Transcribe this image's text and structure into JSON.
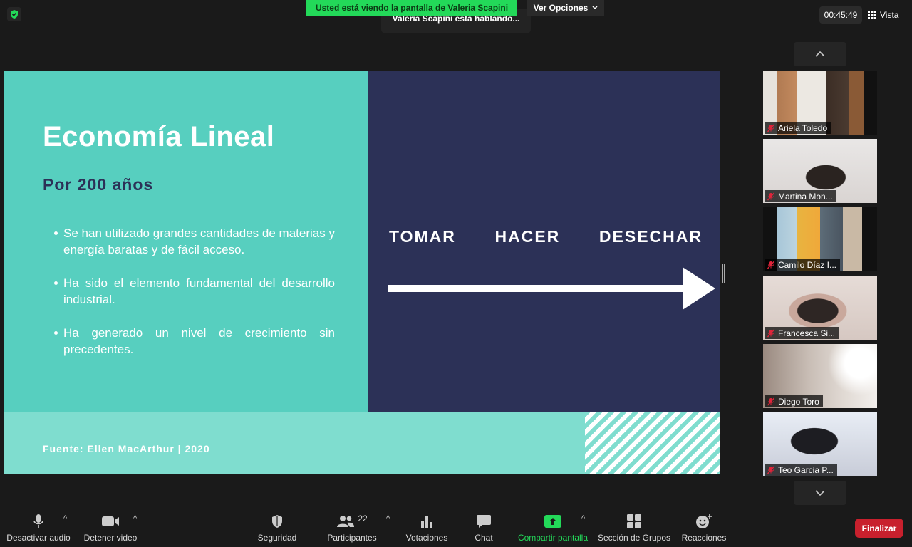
{
  "top_bar": {
    "share_banner": "Usted está viendo la pantalla de Valeria Scapini",
    "view_options": "Ver Opciones",
    "speaking": "Valeria Scapini está hablando...",
    "timer": "00:45:49",
    "view_label": "Vista"
  },
  "slide": {
    "title": "Economía Lineal",
    "subtitle": "Por 200 años",
    "bullets": [
      "Se han utilizado grandes cantidades de materias y energía baratas y de fácil acceso.",
      "Ha sido el elemento fundamental del desarrollo industrial.",
      "Ha generado un nivel de crecimiento sin precedentes."
    ],
    "flow": [
      "TOMAR",
      "HACER",
      "DESECHAR"
    ],
    "source": "Fuente: Ellen MacArthur | 2020",
    "colors": {
      "teal": "#57cfbf",
      "navy": "#2c3157",
      "light_teal": "#7fddcf"
    }
  },
  "participants": [
    {
      "name": "Ariela Toledo",
      "muted": true
    },
    {
      "name": "Martina Mon...",
      "muted": true
    },
    {
      "name": "Camilo Díaz I...",
      "muted": true
    },
    {
      "name": "Francesca Si...",
      "muted": true
    },
    {
      "name": "Diego Toro",
      "muted": true
    },
    {
      "name": "Teo Garcia P...",
      "muted": true
    }
  ],
  "toolbar": {
    "mute_audio": "Desactivar audio",
    "stop_video": "Detener video",
    "security": "Seguridad",
    "participants": "Participantes",
    "participants_count": "22",
    "polls": "Votaciones",
    "chat": "Chat",
    "share_screen": "Compartir pantalla",
    "breakout": "Sección de Grupos",
    "reactions": "Reacciones",
    "end": "Finalizar"
  },
  "icons": [
    "shield-check-icon",
    "chevron-down-icon",
    "grid-icon",
    "chevron-up-icon",
    "mic-icon",
    "video-camera-icon",
    "security-shield-icon",
    "participants-icon",
    "poll-icon",
    "chat-bubble-icon",
    "share-screen-icon",
    "breakout-rooms-icon",
    "reactions-icon",
    "mic-muted-icon"
  ],
  "accent_colors": {
    "green": "#23d959",
    "end_red": "#c8202d"
  }
}
